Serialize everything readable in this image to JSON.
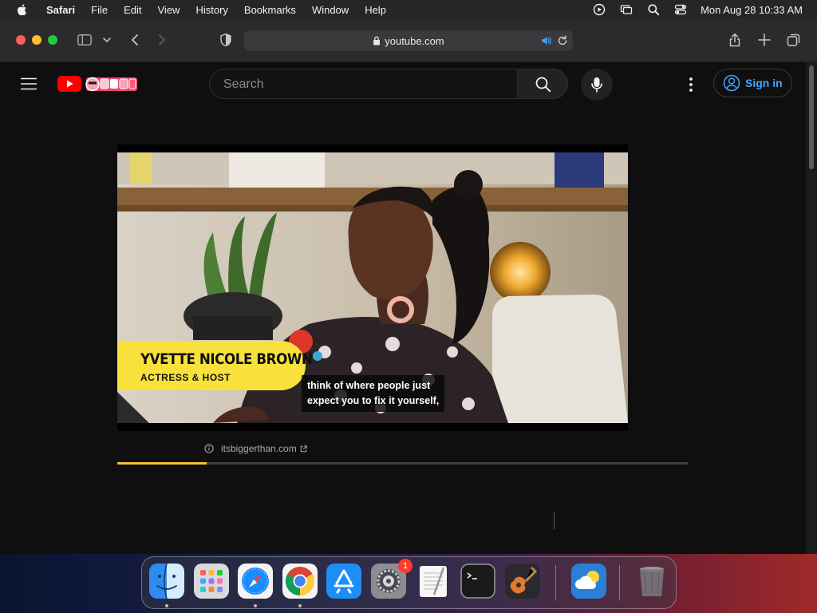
{
  "menubar": {
    "app_name": "Safari",
    "menus": [
      "File",
      "Edit",
      "View",
      "History",
      "Bookmarks",
      "Window",
      "Help"
    ],
    "clock": "Mon Aug 28  10:33 AM"
  },
  "safari": {
    "url": "youtube.com"
  },
  "youtube": {
    "search": {
      "placeholder": "Search"
    },
    "sign_in_label": "Sign in",
    "video": {
      "lower_third": {
        "name": "YVETTE NICOLE BROWN",
        "role": "ACTRESS & HOST"
      },
      "caption_lines": [
        "think of where people just",
        "expect you to fix it yourself,"
      ]
    },
    "info_link": "itsbiggerthan.com",
    "progress": 0.157
  },
  "dock": {
    "apps": [
      {
        "name": "finder",
        "running": true
      },
      {
        "name": "launchpad",
        "running": false
      },
      {
        "name": "safari",
        "running": true
      },
      {
        "name": "chrome",
        "running": true
      },
      {
        "name": "app-store",
        "running": false
      },
      {
        "name": "system-settings",
        "running": false,
        "badge": "1"
      },
      {
        "name": "textedit",
        "running": false
      },
      {
        "name": "terminal",
        "running": false
      },
      {
        "name": "garageband",
        "running": false
      },
      {
        "name": "weather",
        "running": false
      },
      {
        "name": "trash",
        "running": false
      }
    ]
  }
}
